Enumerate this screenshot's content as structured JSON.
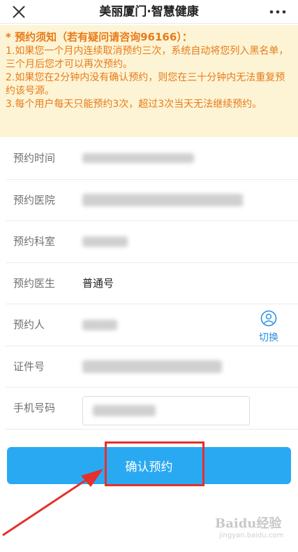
{
  "topbar": {
    "title": "美丽厦门·智慧健康",
    "close_icon": "close-icon",
    "more_icon": "more-dots-icon"
  },
  "notice": {
    "title": "* 预约须知（若有疑问请咨询96166）：",
    "lines": [
      "1.如果您一个月内连续取消预约三次，系统自动将您列入黑名单，三个月后您才可以再次预约。",
      "2.如果您在2分钟内没有确认预约，则您在三十分钟内无法重复预约该号源。",
      "3.每个用户每天只能预约3次，超过3次当天无法继续预约。"
    ]
  },
  "form": {
    "rows": [
      {
        "label": "预约时间",
        "value": ""
      },
      {
        "label": "预约医院",
        "value": ""
      },
      {
        "label": "预约科室",
        "value": ""
      },
      {
        "label": "预约医生",
        "value": "普通号"
      },
      {
        "label": "预约人",
        "value": ""
      },
      {
        "label": "证件号",
        "value": ""
      },
      {
        "label": "手机号码",
        "value": ""
      }
    ],
    "switch_label": "切换",
    "switch_icon": "user-switch-icon"
  },
  "confirm_button": {
    "label": "确认预约"
  },
  "watermark": {
    "main": "Baidu经验",
    "sub": "jingyan.baidu.com"
  },
  "colors": {
    "notice_bg": "#fdf4d5",
    "notice_text": "#e77b1a",
    "button_bg": "#2aa9f3",
    "accent_blue": "#2c8fe6",
    "annotation_red": "#e5302b"
  }
}
